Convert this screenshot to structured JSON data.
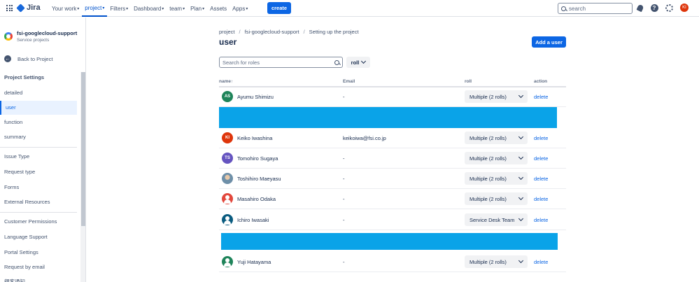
{
  "nav": {
    "logo": "Jira",
    "items": [
      "Your work",
      "project",
      "Filters",
      "Dashboard",
      "team",
      "Plan",
      "Assets",
      "Apps"
    ],
    "create": "create",
    "search_placeholder": "search",
    "user_initials": "KI"
  },
  "sidebar": {
    "project_name": "fsi-googlecloud-support",
    "project_type": "Service projects",
    "back": "Back to Project",
    "heading": "Project Settings",
    "items": [
      "detailed",
      "user",
      "function",
      "summary",
      "Issue Type",
      "Request type",
      "Forms",
      "External Resources",
      "Customer Permissions",
      "Language Support",
      "Portal Settings",
      "Request by email",
      "顧客通知"
    ]
  },
  "main": {
    "breadcrumbs": [
      "project",
      "fsi-googlecloud-support",
      "Setting up the project"
    ],
    "title": "user",
    "add_user": "Add a user",
    "search_placeholder": "Search for roles",
    "roll_filter": "roll",
    "headers": {
      "name": "name",
      "email": "Email",
      "role": "roll",
      "action": "action"
    },
    "rows": [
      {
        "initials": "AS",
        "name": "Ayumu Shimizu",
        "email": "-",
        "role": "Multiple (2 rolls)",
        "action": "delete",
        "color": "#1f845a"
      },
      {
        "initials": "KI",
        "name": "Keiko Iwashina",
        "email": "keikoiwa@fsi.co.jp",
        "role": "Multiple (2 rolls)",
        "action": "delete",
        "color": "#de350b"
      },
      {
        "initials": "TS",
        "name": "Tomohiro Sugaya",
        "email": "-",
        "role": "Multiple (2 rolls)",
        "action": "delete",
        "color": "#6554c0"
      },
      {
        "initials": "",
        "name": "Toshihiro Maeyasu",
        "email": "-",
        "role": "Multiple (2 rolls)",
        "action": "delete",
        "color": "#6e8fa8"
      },
      {
        "initials": "",
        "name": "Masahiro Odaka",
        "email": "-",
        "role": "Multiple (2 rolls)",
        "action": "delete",
        "color": "#e2483d"
      },
      {
        "initials": "",
        "name": "Ichiro Iwasaki",
        "email": "-",
        "role": "Service Desk Team",
        "action": "delete",
        "color": "#0b5c80"
      },
      {
        "initials": "",
        "name": "Yuji Hatayama",
        "email": "-",
        "role": "Multiple (2 rolls)",
        "action": "delete",
        "color": "#1f845a"
      }
    ],
    "redaction_color": "#0aa3e8"
  }
}
